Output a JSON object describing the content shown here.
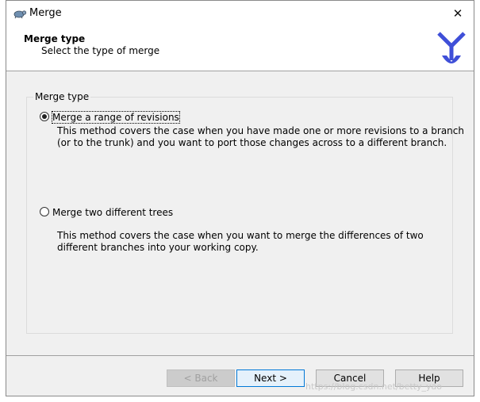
{
  "window": {
    "title": "Merge",
    "close_glyph": "✕"
  },
  "header": {
    "title": "Merge type",
    "subtitle": "Select the type of merge"
  },
  "group": {
    "legend": "Merge type",
    "options": [
      {
        "label": "Merge a range of revisions",
        "selected": true,
        "description_lines": [
          "This method covers the case when you have made one or more revisions to a branch",
          "(or to the trunk) and you want to port those changes across to a different branch."
        ]
      },
      {
        "label": "Merge two different trees",
        "selected": false,
        "description_lines": [
          "This method covers the case when you want to merge the differences of two",
          "different branches into your working copy."
        ]
      }
    ]
  },
  "buttons": {
    "back": "< Back",
    "next": "Next >",
    "cancel": "Cancel",
    "help": "Help"
  },
  "watermark": "https://blog.csdn.net/betty_yao",
  "colors": {
    "dialog_bg": "#f0f0f0",
    "logo_blue": "#3f4fd8",
    "default_button_border": "#0078d7"
  },
  "icons": {
    "app": "tortoise-icon",
    "header_logo": "merge-arrow-icon"
  }
}
